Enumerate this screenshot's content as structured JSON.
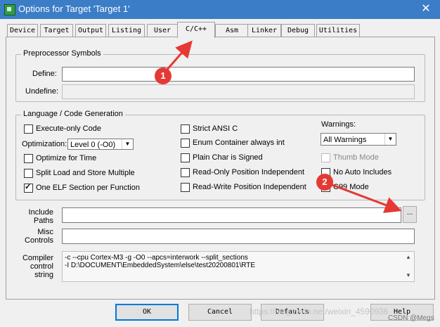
{
  "window": {
    "title": "Options for Target 'Target 1'",
    "close": "✕"
  },
  "tabs": [
    "Device",
    "Target",
    "Output",
    "Listing",
    "User",
    "C/C++",
    "Asm",
    "Linker",
    "Debug",
    "Utilities"
  ],
  "active_tab": "C/C++",
  "preprocessor": {
    "title": "Preprocessor Symbols",
    "define_label": "Define:",
    "define_value": "",
    "undefine_label": "Undefine:",
    "undefine_value": ""
  },
  "language": {
    "title": "Language / Code Generation",
    "execute_only": {
      "label": "Execute-only Code",
      "checked": false
    },
    "optimization_label": "Optimization:",
    "optimization_value": "Level 0 (-O0)",
    "optimize_time": {
      "label": "Optimize for Time",
      "checked": false
    },
    "split_load": {
      "label": "Split Load and Store Multiple",
      "checked": false
    },
    "one_elf": {
      "label": "One ELF Section per Function",
      "checked": true
    },
    "strict_ansi": {
      "label": "Strict ANSI C",
      "checked": false
    },
    "enum_container": {
      "label": "Enum Container always int",
      "checked": false
    },
    "plain_char": {
      "label": "Plain Char is Signed",
      "checked": false
    },
    "ro_pi": {
      "label": "Read-Only Position Independent",
      "checked": false
    },
    "rw_pi": {
      "label": "Read-Write Position Independent",
      "checked": false
    },
    "warnings_label": "Warnings:",
    "warnings_value": "All Warnings",
    "thumb_mode": {
      "label": "Thumb Mode",
      "checked": false,
      "disabled": true
    },
    "no_auto_includes": {
      "label": "No Auto Includes",
      "checked": false
    },
    "c99_mode": {
      "label": "C99 Mode",
      "checked": false
    }
  },
  "include_paths": {
    "label_line1": "Include",
    "label_line2": "Paths",
    "value": "",
    "browse": "..."
  },
  "misc_controls": {
    "label_line1": "Misc",
    "label_line2": "Controls",
    "value": ""
  },
  "compiler_control": {
    "label_line1": "Compiler",
    "label_line2": "control",
    "label_line3": "string",
    "value": "-c --cpu Cortex-M3 -g -O0 --apcs=interwork --split_sections\n-I D:\\DOCUMENT\\EmbeddedSystem\\else\\test20200801\\RTE"
  },
  "buttons": {
    "ok": "OK",
    "cancel": "Cancel",
    "defaults": "Defaults",
    "help": "Help"
  },
  "annotations": {
    "badge1": "1",
    "badge2": "2",
    "color": "#e53935"
  },
  "watermark": "https://blog.csdn.net/weixin_4590936",
  "csdn_tag": "CSDN @Megs"
}
